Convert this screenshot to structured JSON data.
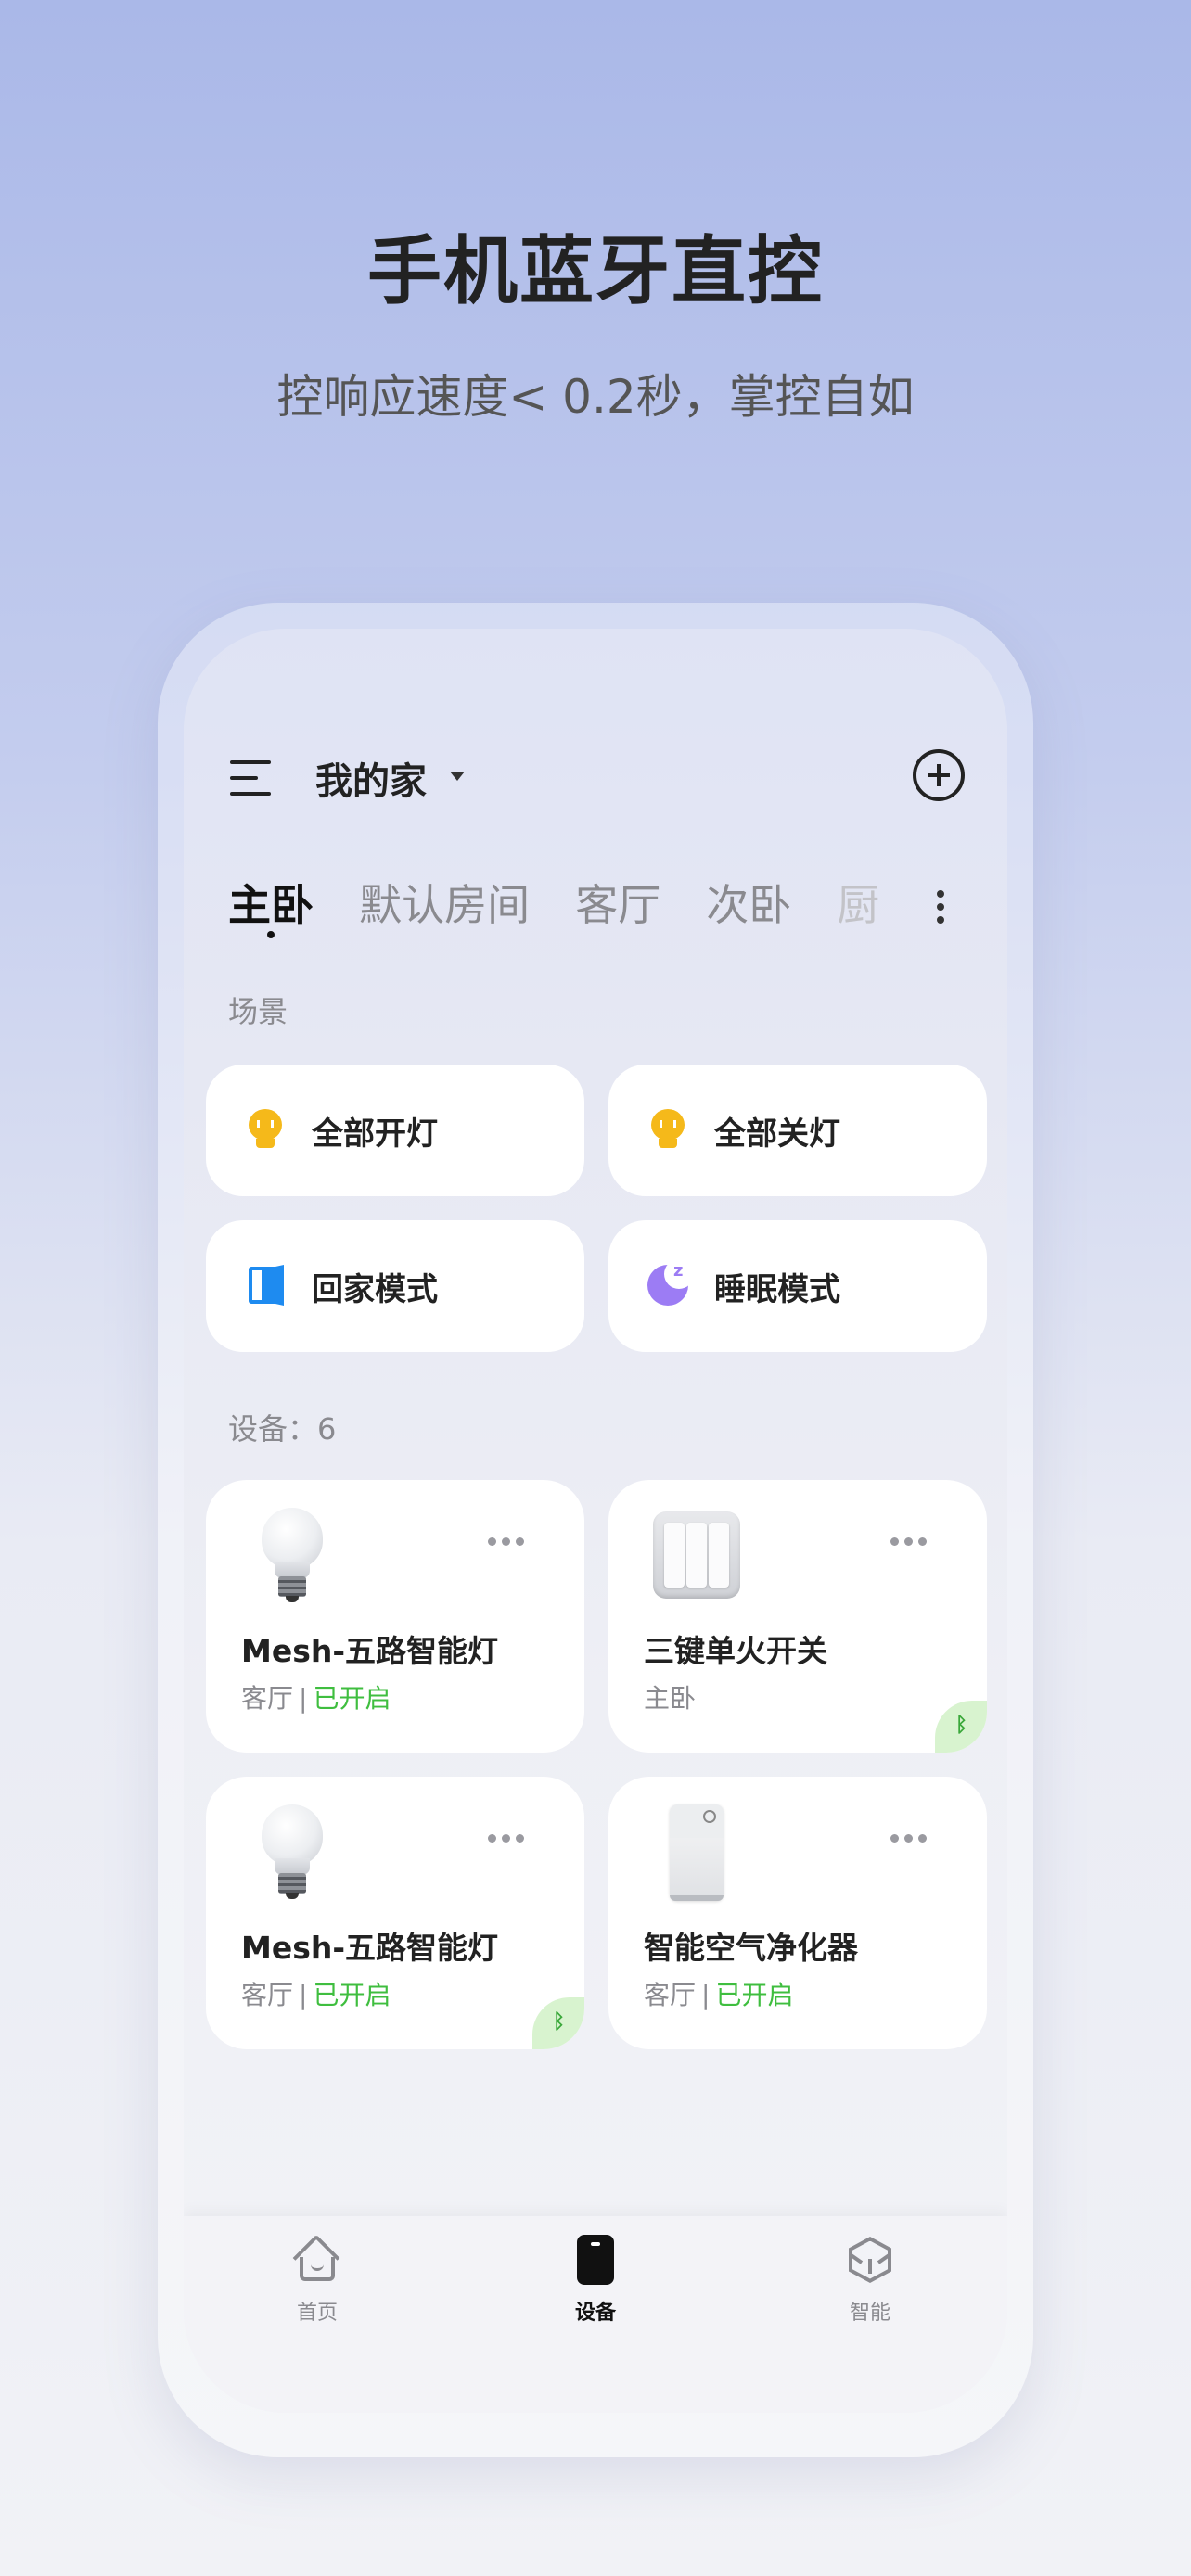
{
  "hero": {
    "title": "手机蓝牙直控",
    "subtitle": "控响应速度< 0.2秒，掌控自如"
  },
  "header": {
    "menu_icon": "menu-icon",
    "home_name": "我的家",
    "dropdown_icon": "caret-down-icon",
    "add_icon": "add-circle-icon"
  },
  "tabs": [
    {
      "label": "主卧",
      "active": true
    },
    {
      "label": "默认房间",
      "active": false
    },
    {
      "label": "客厅",
      "active": false
    },
    {
      "label": "次卧",
      "active": false
    },
    {
      "label": "厨",
      "active": false
    }
  ],
  "tabs_more_icon": "more-vertical-icon",
  "scenes": {
    "label": "场景",
    "items": [
      {
        "label": "全部开灯",
        "icon": "bulb-icon",
        "color": "#f5b91a"
      },
      {
        "label": "全部关灯",
        "icon": "bulb-icon",
        "color": "#f5b91a"
      },
      {
        "label": "回家模式",
        "icon": "door-icon",
        "color": "#1e8bf0"
      },
      {
        "label": "睡眠模式",
        "icon": "moon-icon",
        "color": "#9c7cf4"
      }
    ]
  },
  "devices": {
    "label": "设备：6",
    "items": [
      {
        "name": "Mesh-五路智能灯",
        "room": "客厅",
        "sep": "|",
        "status": "已开启",
        "image": "bulb-image",
        "bluetooth": false
      },
      {
        "name": "三键单火开关",
        "room": "主卧",
        "sep": "",
        "status": "",
        "image": "switch-image",
        "bluetooth": true
      },
      {
        "name": "Mesh-五路智能灯",
        "room": "客厅",
        "sep": "|",
        "status": "已开启",
        "image": "bulb-image",
        "bluetooth": true
      },
      {
        "name": "智能空气净化器",
        "room": "客厅",
        "sep": "|",
        "status": "已开启",
        "image": "purifier-image",
        "bluetooth": false
      }
    ]
  },
  "status_color": "#3fbe3f",
  "bluetooth_glyph": "ᛒ",
  "bottom_nav": [
    {
      "label": "首页",
      "icon": "home-icon",
      "active": false
    },
    {
      "label": "设备",
      "icon": "device-icon",
      "active": true
    },
    {
      "label": "智能",
      "icon": "smart-cube-icon",
      "active": false
    }
  ]
}
